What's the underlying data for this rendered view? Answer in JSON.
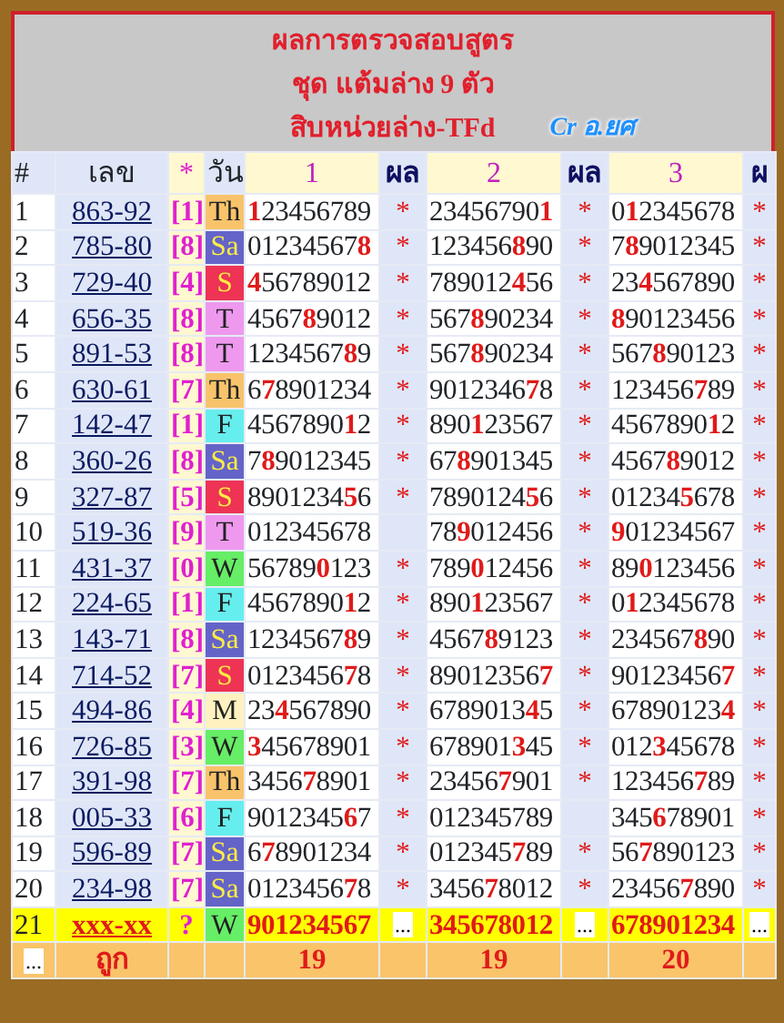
{
  "title_lines": [
    "ผลการตรวจสอบสูตร",
    "ชุด แต้มล่าง 9 ตัว",
    "สิบหน่วยล่าง-TFd"
  ],
  "credit": "Cr อ.ยศ",
  "columns": [
    "#",
    "เลข",
    "*",
    "วัน",
    "1",
    "ผล",
    "2",
    "ผล",
    "3",
    "ผ"
  ],
  "rows": [
    {
      "index": "1",
      "number": "863-92",
      "digit": "[1]",
      "day": "Th",
      "color": "#f9c36b",
      "sets": [
        {
          "value": "**1**23456789",
          "mark": "*"
        },
        {
          "value": "23456790**1**",
          "mark": "*"
        },
        {
          "value": "0**1**2345678",
          "mark": "*"
        }
      ]
    },
    {
      "index": "2",
      "number": "785-80",
      "digit": "[8]",
      "day": "Sa",
      "color": "#6464c8",
      "sets": [
        {
          "value": "01234567**8**",
          "mark": "*"
        },
        {
          "value": "123456**8**90",
          "mark": "*"
        },
        {
          "value": "7**8**9012345",
          "mark": "*"
        }
      ]
    },
    {
      "index": "3",
      "number": "729-40",
      "digit": "[4]",
      "day": "S",
      "color": "#ee3355",
      "sets": [
        {
          "value": "**4**56789012",
          "mark": "*"
        },
        {
          "value": "789012**4**56",
          "mark": "*"
        },
        {
          "value": "23**4**567890",
          "mark": "*"
        }
      ]
    },
    {
      "index": "4",
      "number": "656-35",
      "digit": "[8]",
      "day": "T",
      "color": "#ee99ee",
      "sets": [
        {
          "value": "4567**8**9012",
          "mark": "*"
        },
        {
          "value": "567**8**90234",
          "mark": "*"
        },
        {
          "value": "**8**90123456",
          "mark": "*"
        }
      ]
    },
    {
      "index": "5",
      "number": "891-53",
      "digit": "[8]",
      "day": "T",
      "color": "#ee99ee",
      "sets": [
        {
          "value": "1234567**8**9",
          "mark": "*"
        },
        {
          "value": "567**8**90234",
          "mark": "*"
        },
        {
          "value": "567**8**90123",
          "mark": "*"
        }
      ]
    },
    {
      "index": "6",
      "number": "630-61",
      "digit": "[7]",
      "day": "Th",
      "color": "#f9c36b",
      "sets": [
        {
          "value": "6**7**8901234",
          "mark": "*"
        },
        {
          "value": "9012346**7**8",
          "mark": "*"
        },
        {
          "value": "123456**7**89",
          "mark": "*"
        }
      ]
    },
    {
      "index": "7",
      "number": "142-47",
      "digit": "[1]",
      "day": "F",
      "color": "#66eeee",
      "sets": [
        {
          "value": "4567890**1**2",
          "mark": "*"
        },
        {
          "value": "890**1**23567",
          "mark": "*"
        },
        {
          "value": "4567890**1**2",
          "mark": "*"
        }
      ]
    },
    {
      "index": "8",
      "number": "360-26",
      "digit": "[8]",
      "day": "Sa",
      "color": "#6464c8",
      "sets": [
        {
          "value": "7**8**9012345",
          "mark": "*"
        },
        {
          "value": "67**8**901345",
          "mark": "*"
        },
        {
          "value": "4567**8**9012",
          "mark": "*"
        }
      ]
    },
    {
      "index": "9",
      "number": "327-87",
      "digit": "[5]",
      "day": "S",
      "color": "#ee3355",
      "sets": [
        {
          "value": "8901234**5**6",
          "mark": "*"
        },
        {
          "value": "7890124**5**6",
          "mark": "*"
        },
        {
          "value": "01234**5**678",
          "mark": "*"
        }
      ]
    },
    {
      "index": "10",
      "number": "519-36",
      "digit": "[9]",
      "day": "T",
      "color": "#ee99ee",
      "sets": [
        {
          "value": "012345678"
        },
        {
          "value": "78**9**012456",
          "mark": "*"
        },
        {
          "value": "**9**01234567",
          "mark": "*"
        }
      ]
    },
    {
      "index": "11",
      "number": "431-37",
      "digit": "[0]",
      "day": "W",
      "color": "#66ee66",
      "sets": [
        {
          "value": "56789**0**123",
          "mark": "*"
        },
        {
          "value": "789**0**12456",
          "mark": "*"
        },
        {
          "value": "89**0**123456",
          "mark": "*"
        }
      ]
    },
    {
      "index": "12",
      "number": "224-65",
      "digit": "[1]",
      "day": "F",
      "color": "#66eeee",
      "sets": [
        {
          "value": "4567890**1**2",
          "mark": "*"
        },
        {
          "value": "890**1**23567",
          "mark": "*"
        },
        {
          "value": "0**1**2345678",
          "mark": "*"
        }
      ]
    },
    {
      "index": "13",
      "number": "143-71",
      "digit": "[8]",
      "day": "Sa",
      "color": "#6464c8",
      "sets": [
        {
          "value": "1234567**8**9",
          "mark": "*"
        },
        {
          "value": "4567**8**9123",
          "mark": "*"
        },
        {
          "value": "234567**8**90",
          "mark": "*"
        }
      ]
    },
    {
      "index": "14",
      "number": "714-52",
      "digit": "[7]",
      "day": "S",
      "color": "#ee3355",
      "sets": [
        {
          "value": "0123456**7**8",
          "mark": "*"
        },
        {
          "value": "89012356**7**",
          "mark": "*"
        },
        {
          "value": "90123456**7**",
          "mark": "*"
        }
      ]
    },
    {
      "index": "15",
      "number": "494-86",
      "digit": "[4]",
      "day": "M",
      "color": "#fff2c0",
      "sets": [
        {
          "value": "23**4**567890",
          "mark": "*"
        },
        {
          "value": "6789013**4**5",
          "mark": "*"
        },
        {
          "value": "67890123**4**",
          "mark": "*"
        }
      ]
    },
    {
      "index": "16",
      "number": "726-85",
      "digit": "[3]",
      "day": "W",
      "color": "#66ee66",
      "sets": [
        {
          "value": "**3**45678901",
          "mark": "*"
        },
        {
          "value": "678901**3**45",
          "mark": "*"
        },
        {
          "value": "012**3**45678",
          "mark": "*"
        }
      ]
    },
    {
      "index": "17",
      "number": "391-98",
      "digit": "[7]",
      "day": "Th",
      "color": "#f9c36b",
      "sets": [
        {
          "value": "3456**7**8901",
          "mark": "*"
        },
        {
          "value": "23456**7**901",
          "mark": "*"
        },
        {
          "value": "123456**7**89",
          "mark": "*"
        }
      ]
    },
    {
      "index": "18",
      "number": "005-33",
      "digit": "[6]",
      "day": "F",
      "color": "#66eeee",
      "sets": [
        {
          "value": "9012345**6**7",
          "mark": "*"
        },
        {
          "value": "012345789"
        },
        {
          "value": "345**6**78901",
          "mark": "*"
        }
      ]
    },
    {
      "index": "19",
      "number": "596-89",
      "digit": "[7]",
      "day": "Sa",
      "color": "#6464c8",
      "sets": [
        {
          "value": "6**7**8901234",
          "mark": "*"
        },
        {
          "value": "012345**7**89",
          "mark": "*"
        },
        {
          "value": "56**7**890123",
          "mark": "*"
        }
      ]
    },
    {
      "index": "20",
      "number": "234-98",
      "digit": "[7]",
      "day": "Sa",
      "color": "#6464c8",
      "sets": [
        {
          "value": "0123456**7**8",
          "mark": "*"
        },
        {
          "value": "3456**7**8012",
          "mark": "*"
        },
        {
          "value": "23456**7**890",
          "mark": "*"
        }
      ]
    }
  ],
  "forecast_row": {
    "index": "21",
    "number": "xxx-xx",
    "digit": "?",
    "day": "W",
    "color": "#66ee66",
    "sets": [
      {
        "value": "901234567",
        "mark": "..."
      },
      {
        "value": "345678012",
        "mark": "..."
      },
      {
        "value": "678901234",
        "mark": "..."
      }
    ]
  },
  "footer": {
    "mark": "...",
    "label": "ถูก",
    "counts": [
      "19",
      "19",
      "20"
    ]
  }
}
